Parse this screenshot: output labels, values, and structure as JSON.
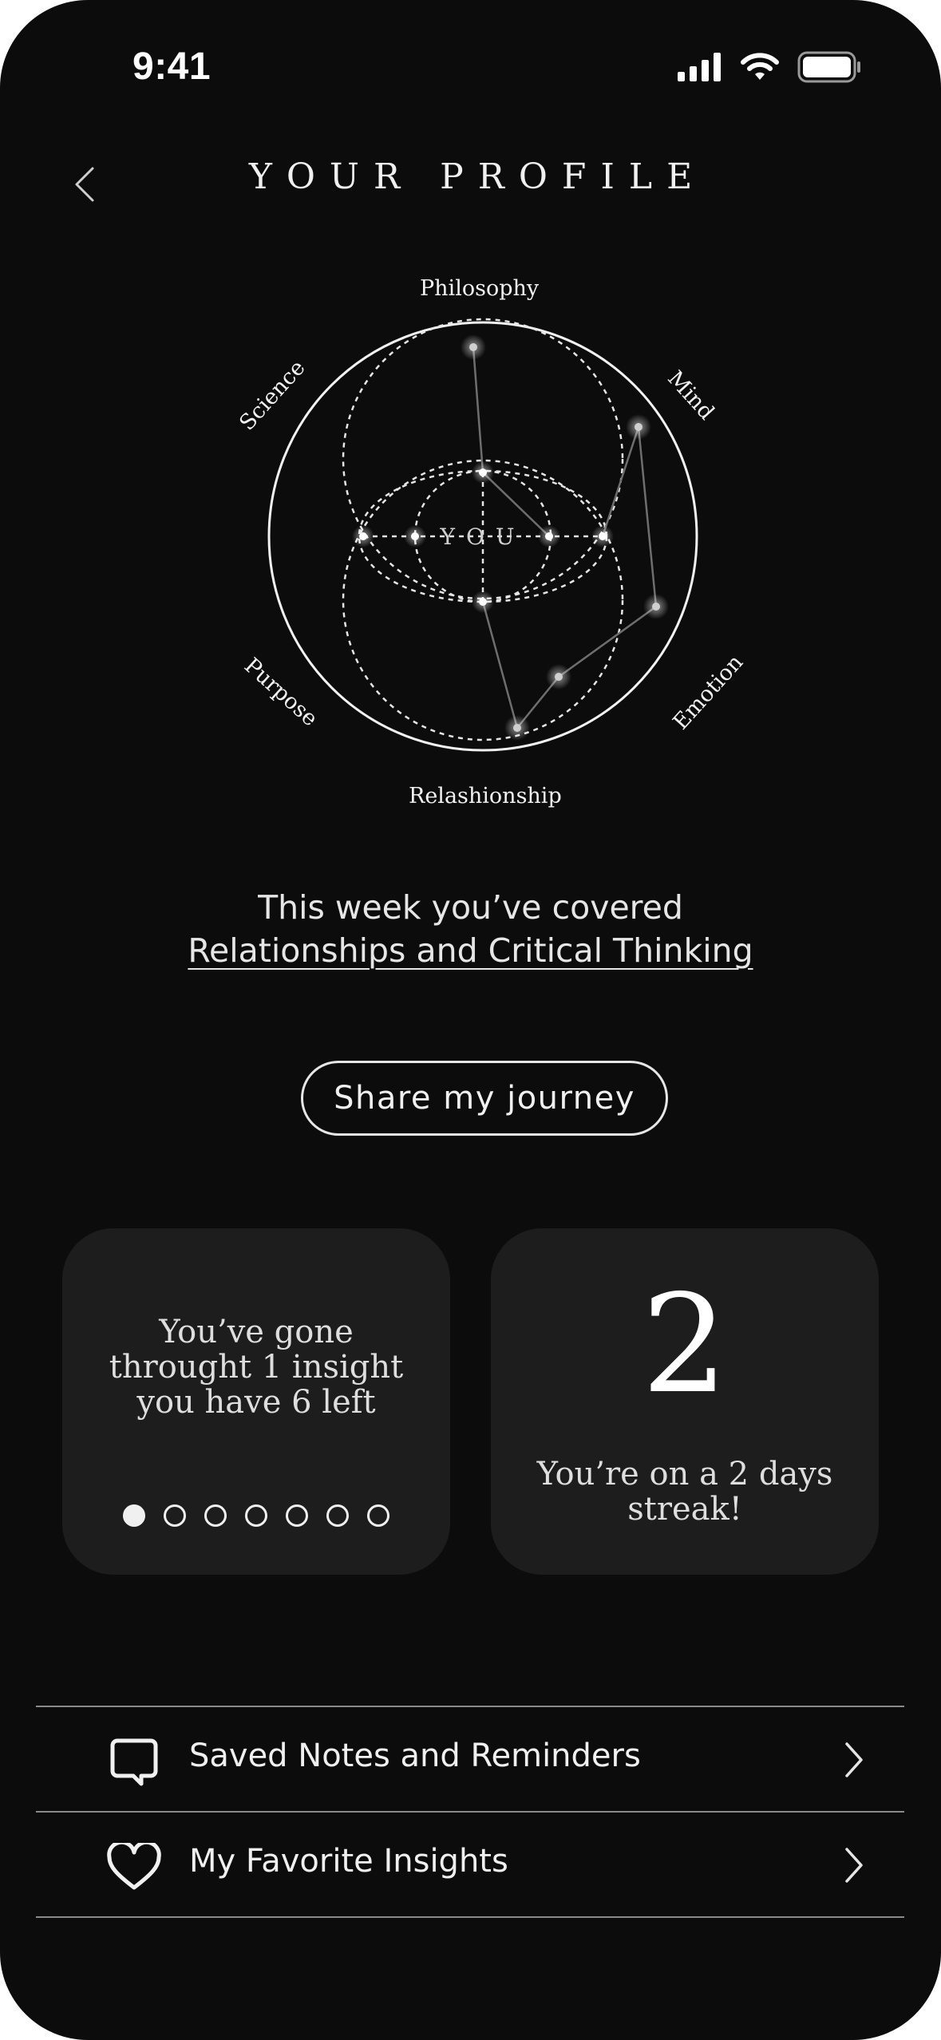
{
  "status_bar": {
    "time": "9:41"
  },
  "header": {
    "title": "YOUR PROFILE"
  },
  "diagram": {
    "center_label": "YOU",
    "labels": {
      "top": "Philosophy",
      "top_right": "Mind",
      "bottom_right": "Emotion",
      "bottom": "Relashionship",
      "bottom_left": "Purpose",
      "top_left": "Science"
    }
  },
  "summary": {
    "line1": "This week you’ve covered",
    "topics": "Relationships and Critical Thinking"
  },
  "share_button": {
    "label": "Share my journey"
  },
  "insights_card": {
    "text": "You’ve gone throught 1 insight you have 6 left",
    "progress": {
      "completed": 1,
      "total": 7
    }
  },
  "streak_card": {
    "number": "2",
    "text": "You’re on a 2 days streak!"
  },
  "menu": {
    "items": [
      {
        "label": "Saved Notes and Reminders",
        "icon": "chat-bubble-icon"
      },
      {
        "label": "My Favorite Insights",
        "icon": "heart-icon"
      }
    ]
  },
  "colors": {
    "background": "#0c0c0c",
    "card": "#1d1d1d",
    "text": "#e9e9e9"
  }
}
